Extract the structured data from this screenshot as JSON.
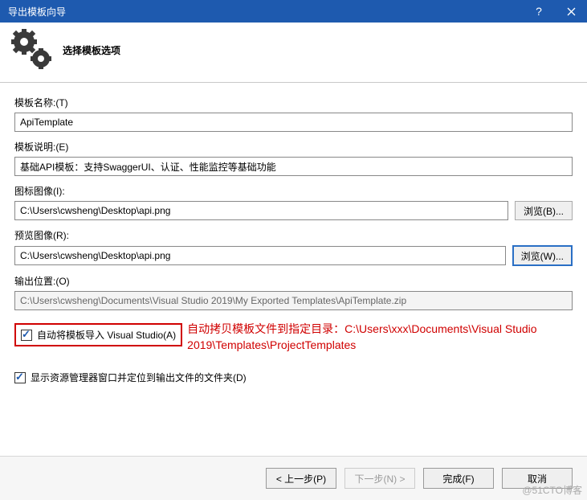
{
  "titlebar": {
    "title": "导出模板向导"
  },
  "header": {
    "title": "选择模板选项"
  },
  "fields": {
    "templateName": {
      "label": "模板名称:(T)",
      "value": "ApiTemplate"
    },
    "templateDesc": {
      "label": "模板说明:(E)",
      "value": "基础API模板：支持SwaggerUI、认证、性能监控等基础功能"
    },
    "iconImage": {
      "label": "图标图像(I):",
      "value": "C:\\Users\\cwsheng\\Desktop\\api.png",
      "browse": "浏览(B)..."
    },
    "previewImage": {
      "label": "预览图像(R):",
      "value": "C:\\Users\\cwsheng\\Desktop\\api.png",
      "browse": "浏览(W)..."
    },
    "outputLocation": {
      "label": "输出位置:(O)",
      "value": "C:\\Users\\cwsheng\\Documents\\Visual Studio 2019\\My Exported Templates\\ApiTemplate.zip"
    }
  },
  "checkboxes": {
    "autoImport": {
      "label": "自动将模板导入 Visual Studio(A)",
      "checked": true
    },
    "openExplorer": {
      "label": "显示资源管理器窗口并定位到输出文件的文件夹(D)",
      "checked": true
    }
  },
  "annotation": "自动拷贝模板文件到指定目录：C:\\Users\\xxx\\Documents\\Visual Studio 2019\\Templates\\ProjectTemplates",
  "buttons": {
    "prev": "< 上一步(P)",
    "next": "下一步(N) >",
    "finish": "完成(F)",
    "cancel": "取消"
  },
  "watermark": "@51CTO博客"
}
